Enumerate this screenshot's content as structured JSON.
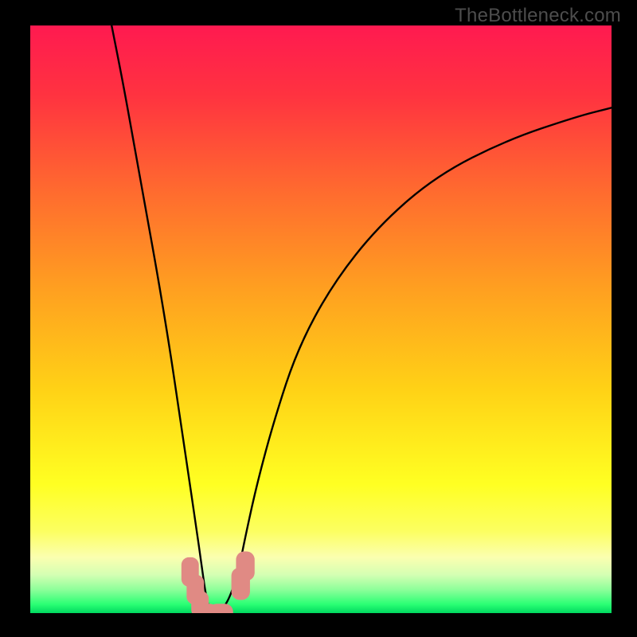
{
  "watermark": "TheBottleneck.com",
  "chart_data": {
    "type": "line",
    "title": "",
    "xlabel": "",
    "ylabel": "",
    "xlim": [
      0,
      100
    ],
    "ylim": [
      0,
      100
    ],
    "background_gradient": {
      "stops": [
        {
          "pos": 0.0,
          "color": "#ff1a50"
        },
        {
          "pos": 0.12,
          "color": "#ff3340"
        },
        {
          "pos": 0.28,
          "color": "#ff6a2f"
        },
        {
          "pos": 0.45,
          "color": "#ffa020"
        },
        {
          "pos": 0.62,
          "color": "#ffd216"
        },
        {
          "pos": 0.78,
          "color": "#ffff22"
        },
        {
          "pos": 0.86,
          "color": "#fcff60"
        },
        {
          "pos": 0.905,
          "color": "#fbffb0"
        },
        {
          "pos": 0.935,
          "color": "#d4ffb3"
        },
        {
          "pos": 0.96,
          "color": "#8dff9a"
        },
        {
          "pos": 0.985,
          "color": "#2bff74"
        },
        {
          "pos": 1.0,
          "color": "#00d95f"
        }
      ]
    },
    "series": [
      {
        "name": "bottleneck-curve",
        "x": [
          14,
          16,
          18,
          20,
          22,
          24,
          25.5,
          27,
          28.5,
          29.5,
          30.2,
          31,
          32,
          33,
          34.5,
          36,
          37,
          39,
          42,
          46,
          52,
          60,
          70,
          82,
          94,
          100
        ],
        "y": [
          100,
          90,
          79,
          68,
          57,
          45,
          35,
          25,
          15,
          8,
          3,
          0,
          0,
          0.5,
          3,
          8,
          13,
          22,
          33,
          45,
          56,
          66,
          74.5,
          80.5,
          84.5,
          86
        ]
      }
    ],
    "marker_clusters": [
      {
        "name": "left-cluster",
        "color": "#e08a84",
        "points": [
          {
            "x": 27.5,
            "y": 7.0,
            "w": 3.0,
            "h": 5.0,
            "r": 1.3
          },
          {
            "x": 28.4,
            "y": 4.0,
            "w": 3.0,
            "h": 5.0,
            "r": 1.3
          },
          {
            "x": 29.2,
            "y": 1.5,
            "w": 3.0,
            "h": 4.5,
            "r": 1.3
          }
        ]
      },
      {
        "name": "bottom-cluster",
        "color": "#e08a84",
        "points": [
          {
            "x": 30.2,
            "y": 0.0,
            "w": 4.2,
            "h": 3.2,
            "r": 1.4
          },
          {
            "x": 32.8,
            "y": 0.0,
            "w": 4.2,
            "h": 3.2,
            "r": 1.4
          }
        ]
      },
      {
        "name": "right-cluster",
        "color": "#e08a84",
        "points": [
          {
            "x": 36.2,
            "y": 5.0,
            "w": 3.2,
            "h": 5.5,
            "r": 1.4
          },
          {
            "x": 37.0,
            "y": 8.0,
            "w": 3.2,
            "h": 5.0,
            "r": 1.4
          }
        ]
      }
    ]
  }
}
